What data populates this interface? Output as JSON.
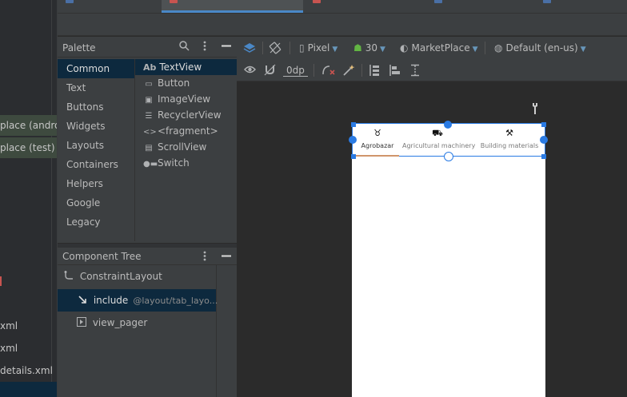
{
  "project": {
    "items": [
      "place (androi",
      "place (test)",
      "xml",
      "xml",
      "details.xml"
    ]
  },
  "palette": {
    "title": "Palette",
    "categories": [
      "Common",
      "Text",
      "Buttons",
      "Widgets",
      "Layouts",
      "Containers",
      "Helpers",
      "Google",
      "Legacy"
    ],
    "widgets": [
      {
        "label": "TextView",
        "icon": "textview-icon",
        "glyph": "Ab"
      },
      {
        "label": "Button",
        "icon": "button-icon",
        "glyph": "▭"
      },
      {
        "label": "ImageView",
        "icon": "imageview-icon",
        "glyph": "▣"
      },
      {
        "label": "RecyclerView",
        "icon": "recyclerview-icon",
        "glyph": "☰"
      },
      {
        "label": "<fragment>",
        "icon": "fragment-icon",
        "glyph": "<>"
      },
      {
        "label": "ScrollView",
        "icon": "scrollview-icon",
        "glyph": "▤"
      },
      {
        "label": "Switch",
        "icon": "switch-icon",
        "glyph": "●▬"
      }
    ]
  },
  "component_tree": {
    "title": "Component Tree",
    "rows": [
      {
        "label": "ConstraintLayout",
        "meta": ""
      },
      {
        "label": "include",
        "meta": "@layout/tab_layo..."
      },
      {
        "label": "view_pager",
        "meta": ""
      }
    ]
  },
  "toolbar": {
    "device": "Pixel",
    "api": "30",
    "theme": "MarketPlace",
    "locale": "Default (en-us)",
    "margin": "0dp"
  },
  "preview": {
    "tabs": [
      {
        "label": "Agrobazar",
        "icon": "cow-icon",
        "glyph": "♉"
      },
      {
        "label": "Agricultural machinery",
        "icon": "tractor-icon",
        "glyph": "⛟"
      },
      {
        "label": "Building materials",
        "icon": "tools-icon",
        "glyph": "⚒"
      }
    ]
  },
  "colors": {
    "accent": "#2a7be4",
    "indicator": "#d0956b",
    "selection": "#0d293e"
  }
}
